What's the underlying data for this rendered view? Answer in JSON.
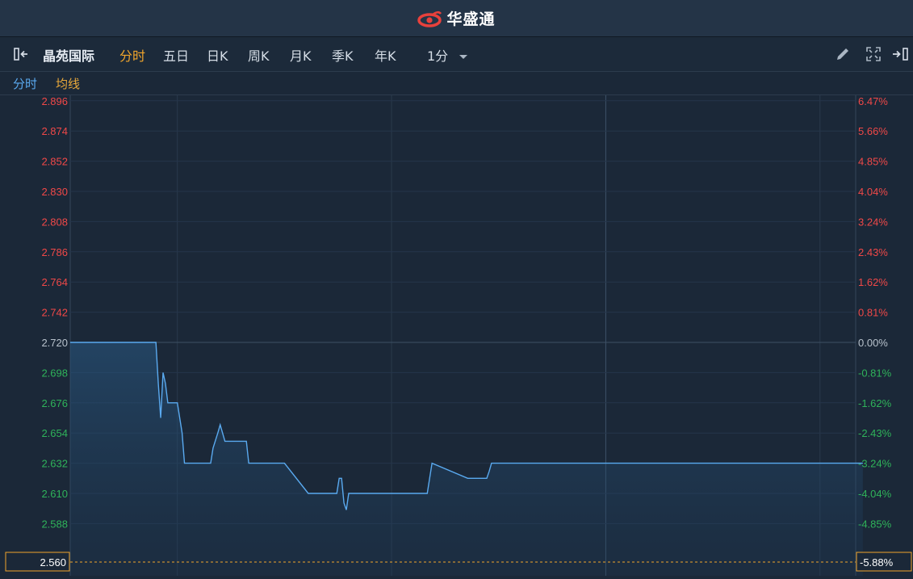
{
  "brand": {
    "name": "华盛通"
  },
  "toolbar": {
    "stock_name": "晶苑国际",
    "tabs": [
      "分时",
      "五日",
      "日K",
      "周K",
      "月K",
      "季K",
      "年K"
    ],
    "active_tab": "分时",
    "interval": "1分"
  },
  "legend": {
    "time_label": "分时",
    "avg_label": "均线"
  },
  "colors": {
    "up": "#f04848",
    "down": "#2fb35a",
    "flat": "#b8c2cc",
    "price_line": "#5aaaf0",
    "avg_line": "#e8a83a",
    "background": "#1b2838",
    "accent": "#f0a52c"
  },
  "chart_data": {
    "type": "line",
    "prev_close": 2.72,
    "ylim": [
      2.55,
      2.9
    ],
    "y_ticks": [
      {
        "price": "2.896",
        "pct": "6.47%"
      },
      {
        "price": "2.874",
        "pct": "5.66%"
      },
      {
        "price": "2.852",
        "pct": "4.85%"
      },
      {
        "price": "2.830",
        "pct": "4.04%"
      },
      {
        "price": "2.808",
        "pct": "3.24%"
      },
      {
        "price": "2.786",
        "pct": "2.43%"
      },
      {
        "price": "2.764",
        "pct": "1.62%"
      },
      {
        "price": "2.742",
        "pct": "0.81%"
      },
      {
        "price": "2.720",
        "pct": "0.00%"
      },
      {
        "price": "2.698",
        "pct": "-0.81%"
      },
      {
        "price": "2.676",
        "pct": "-1.62%"
      },
      {
        "price": "2.654",
        "pct": "-2.43%"
      },
      {
        "price": "2.632",
        "pct": "-3.24%"
      },
      {
        "price": "2.610",
        "pct": "-4.04%"
      },
      {
        "price": "2.588",
        "pct": "-4.85%"
      }
    ],
    "last": {
      "price": "2.560",
      "pct": "-5.88%"
    },
    "x_total": 330,
    "vgrid_minutes": [
      45,
      135,
      225,
      315
    ],
    "series": [
      {
        "role": "price",
        "x": [
          0,
          36,
          37,
          38,
          39,
          40,
          41,
          42,
          45,
          46,
          47,
          48,
          49,
          50,
          59,
          60,
          62,
          63,
          64,
          65,
          74,
          75,
          79,
          80,
          90,
          100,
          101,
          112,
          113,
          114,
          115,
          116,
          117,
          140,
          150,
          151,
          152,
          167,
          168,
          173,
          174,
          175,
          176,
          177,
          178,
          179,
          180,
          181,
          188,
          189,
          200,
          201,
          202,
          204,
          210,
          211,
          212,
          219,
          220,
          225,
          226,
          227,
          228,
          233,
          242,
          243,
          244,
          245,
          246,
          249,
          250,
          251,
          252,
          253,
          254,
          255,
          256,
          257,
          258,
          262,
          263,
          272,
          278,
          280,
          301,
          305,
          306,
          307,
          312,
          313,
          318,
          319,
          325,
          333
        ],
        "y": [
          2.72,
          2.72,
          2.69,
          2.665,
          2.698,
          2.69,
          2.676,
          2.676,
          2.676,
          2.665,
          2.654,
          2.632,
          2.632,
          2.632,
          2.632,
          2.643,
          2.654,
          2.66,
          2.654,
          2.648,
          2.648,
          2.632,
          2.632,
          2.632,
          2.632,
          2.61,
          2.61,
          2.61,
          2.621,
          2.621,
          2.603,
          2.598,
          2.61,
          2.61,
          2.61,
          2.621,
          2.632,
          2.621,
          2.621,
          2.621,
          2.621,
          2.621,
          2.626,
          2.632,
          2.632,
          2.632,
          2.632,
          2.632,
          2.632,
          2.632,
          2.632,
          2.632,
          2.632,
          2.632,
          2.632,
          2.632,
          2.632,
          2.632,
          2.632,
          2.632,
          2.632,
          2.632,
          2.632,
          2.632,
          2.632,
          2.632,
          2.632,
          2.632,
          2.632,
          2.632,
          2.632,
          2.632,
          2.632,
          2.632,
          2.632,
          2.632,
          2.632,
          2.632,
          2.632,
          2.632,
          2.632,
          2.632,
          2.632,
          2.632,
          2.632,
          2.632,
          2.632,
          2.632,
          2.632,
          2.632,
          2.632,
          2.632,
          2.632,
          2.632
        ]
      },
      {
        "role": "avg",
        "x": [],
        "y": []
      }
    ]
  }
}
